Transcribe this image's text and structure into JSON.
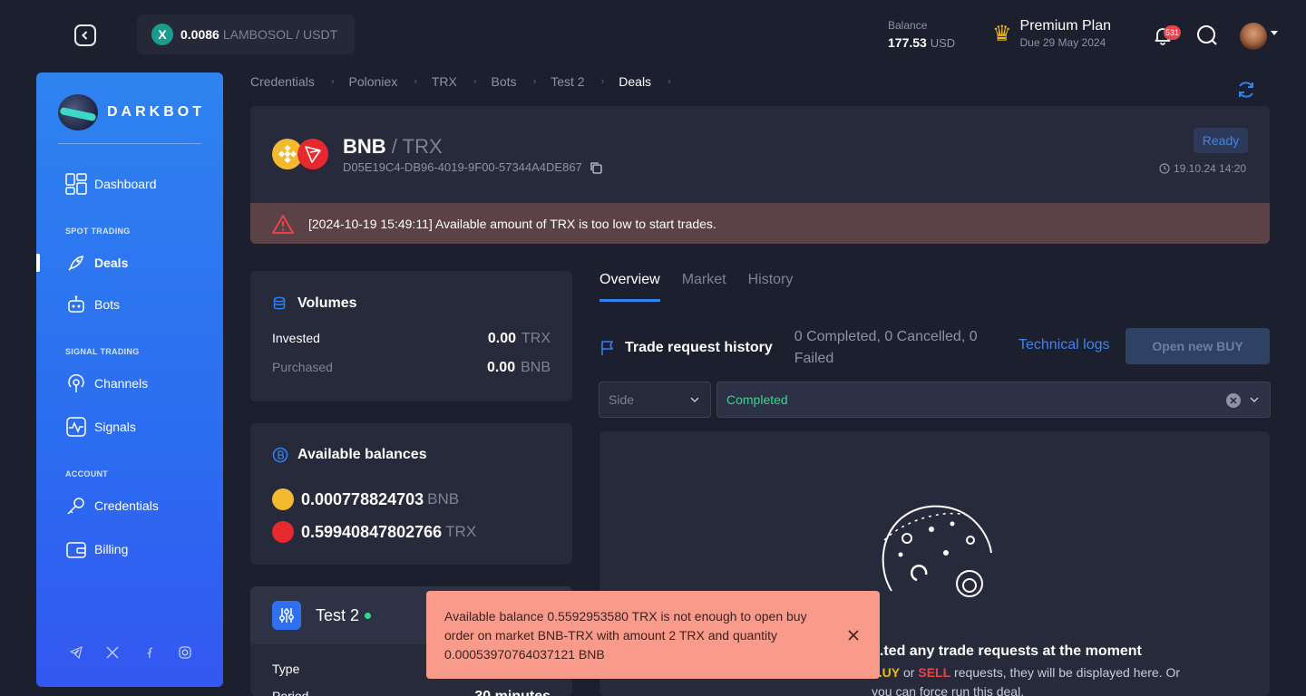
{
  "topbar": {
    "ticker": {
      "coin_symbol": "X",
      "price": "0.0086",
      "pair": "LAMBOSOL / USDT"
    },
    "balance": {
      "label": "Balance",
      "value": "177.53",
      "currency": "USD"
    },
    "plan": {
      "name": "Premium Plan",
      "due": "Due 29 May 2024",
      "icon": "crown-icon"
    },
    "notifications_count": "531"
  },
  "sidebar": {
    "logo_text": "DARKBOT",
    "items": [
      {
        "label": "Dashboard",
        "icon": "dashboard-icon"
      },
      {
        "label": "Deals",
        "icon": "rocket-icon",
        "active": true
      },
      {
        "label": "Bots",
        "icon": "robot-icon"
      },
      {
        "label": "Channels",
        "icon": "broadcast-icon"
      },
      {
        "label": "Signals",
        "icon": "pulse-icon"
      },
      {
        "label": "Credentials",
        "icon": "key-icon"
      },
      {
        "label": "Billing",
        "icon": "wallet-icon"
      }
    ],
    "sections": {
      "spot": "SPOT TRADING",
      "signal": "SIGNAL TRADING",
      "account": "ACCOUNT"
    }
  },
  "breadcrumbs": [
    "Credentials",
    "Poloniex",
    "TRX",
    "Bots",
    "Test 2",
    "Deals"
  ],
  "deal": {
    "base": "BNB",
    "quote": "/ TRX",
    "id": "D05E19C4-DB96-4019-9F00-57344A4DE867",
    "status": "Ready",
    "date": "19.10.24 14:20",
    "warning": "[2024-10-19 15:49:11] Available amount of TRX is too low to start trades."
  },
  "volumes": {
    "title": "Volumes",
    "rows": [
      {
        "label": "Invested",
        "value": "0.00",
        "unit": "TRX"
      },
      {
        "label": "Purchased",
        "value": "0.00",
        "unit": "BNB"
      }
    ]
  },
  "balances": {
    "title": "Available balances",
    "rows": [
      {
        "value": "0.000778824703",
        "unit": "BNB",
        "color": "#f3ba2f"
      },
      {
        "value": "0.59940847802766",
        "unit": "TRX",
        "color": "#e7282f"
      }
    ]
  },
  "bot": {
    "name": "Test 2",
    "rows": [
      {
        "label": "Type",
        "value": ""
      },
      {
        "label": "Period",
        "value": "30 minutes"
      }
    ]
  },
  "tabs": [
    "Overview",
    "Market",
    "History"
  ],
  "trades": {
    "title": "Trade request history",
    "stats": "0 Completed, 0 Cancelled, 0 Failed",
    "tech_logs": "Technical logs",
    "open_buy": "Open new BUY",
    "side_placeholder": "Side",
    "status_value": "Completed",
    "empty_title": "...ted any trade requests at the moment",
    "empty_text_pre": "...UY",
    "empty_or": "or",
    "empty_sell": "SELL",
    "empty_text_post": "requests, they will be displayed here. Or you can force run this deal."
  },
  "toast": {
    "message": "Available balance 0.5592953580 TRX is not enough to open buy order on market BNB-TRX with amount 2 TRX and quantity 0.00053970764037121 BNB"
  },
  "colors": {
    "accent": "#2f83f0",
    "bg": "#1c1f2e",
    "card": "#262a3b",
    "success": "#3ad48c",
    "danger": "#e8424a",
    "toast": "#f99a8a"
  }
}
